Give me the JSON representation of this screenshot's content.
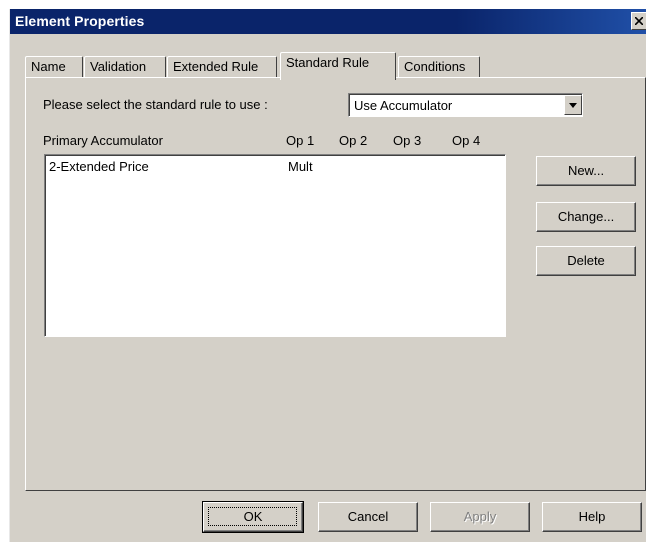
{
  "window": {
    "title": "Element Properties",
    "close_label": "X"
  },
  "tabs": [
    {
      "label": "Name"
    },
    {
      "label": "Validation"
    },
    {
      "label": "Extended Rule"
    },
    {
      "label": "Standard Rule",
      "active": true
    },
    {
      "label": "Conditions"
    }
  ],
  "panel": {
    "select_prompt": "Please select the standard rule to use :",
    "rule_dropdown": {
      "selected": "Use Accumulator"
    },
    "list_headers": {
      "primary": "Primary Accumulator",
      "op1": "Op 1",
      "op2": "Op 2",
      "op3": "Op 3",
      "op4": "Op 4"
    },
    "list_rows": [
      {
        "primary": "2-Extended Price",
        "op1": "Mult",
        "op2": "",
        "op3": "",
        "op4": ""
      }
    ],
    "buttons": {
      "new": "New...",
      "change": "Change...",
      "delete": "Delete"
    }
  },
  "footer": {
    "ok": "OK",
    "cancel": "Cancel",
    "apply": "Apply",
    "help": "Help"
  },
  "colors": {
    "titlebar": "#0a246a",
    "face": "#d4d0c8"
  }
}
